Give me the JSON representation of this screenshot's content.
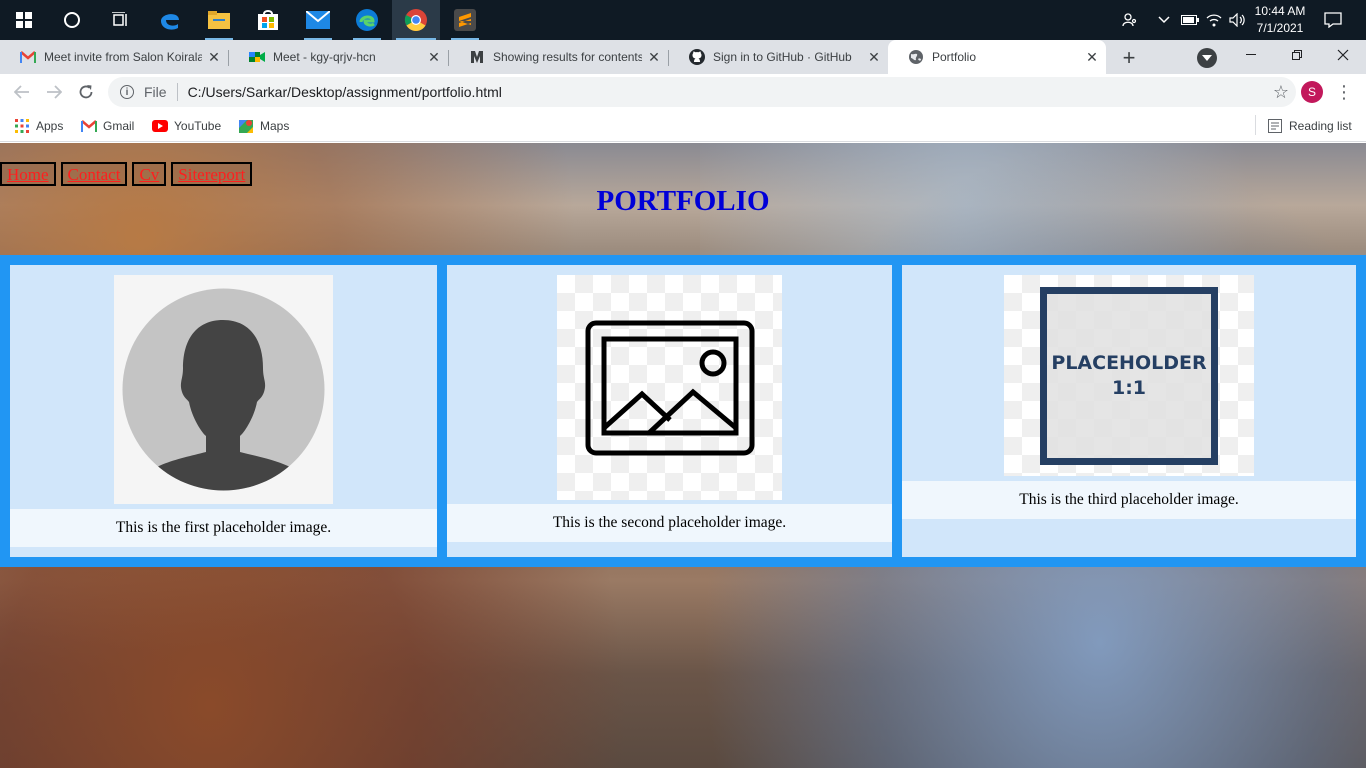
{
  "taskbar": {
    "clock_time": "10:44 AM",
    "clock_date": "7/1/2021"
  },
  "browser": {
    "tabs": [
      {
        "title": "Meet invite from Salon Koirala",
        "favicon": "gmail-icon"
      },
      {
        "title": "Meet - kgy-qrjv-hcn",
        "favicon": "meet-icon"
      },
      {
        "title": "Showing results for contents",
        "favicon": "unknown-icon"
      },
      {
        "title": "Sign in to GitHub · GitHub",
        "favicon": "github-icon"
      },
      {
        "title": "Portfolio",
        "favicon": "globe-icon",
        "active": true
      }
    ],
    "new_tab_label": "+",
    "address": {
      "scheme": "File",
      "url": "C:/Users/Sarkar/Desktop/assignment/portfolio.html"
    },
    "profile_initial": "S",
    "bookmarks": [
      {
        "label": "Apps",
        "icon": "apps-grid-icon"
      },
      {
        "label": "Gmail",
        "icon": "gmail-icon"
      },
      {
        "label": "YouTube",
        "icon": "youtube-icon"
      },
      {
        "label": "Maps",
        "icon": "maps-icon"
      }
    ],
    "reading_list_label": "Reading list"
  },
  "page": {
    "nav": [
      "Home",
      "Contact",
      "Cv",
      "Sitereport"
    ],
    "title": "PORTFOLIO",
    "cards": [
      {
        "caption": "This is the first placeholder image.",
        "image": "avatar-placeholder"
      },
      {
        "caption": "This is the second placeholder image.",
        "image": "image-placeholder"
      },
      {
        "caption": "This is the third placeholder image.",
        "image": "square-placeholder",
        "image_text_1": "PLACEHOLDER",
        "image_text_2": "1:1"
      }
    ]
  },
  "colors": {
    "taskbar": "#0f1a24",
    "gallery_band": "#2196f3",
    "card_bg": "#d1e6fa",
    "nav_link": "#ff1e1e",
    "title": "#0000d8",
    "profile": "#c2185b"
  }
}
